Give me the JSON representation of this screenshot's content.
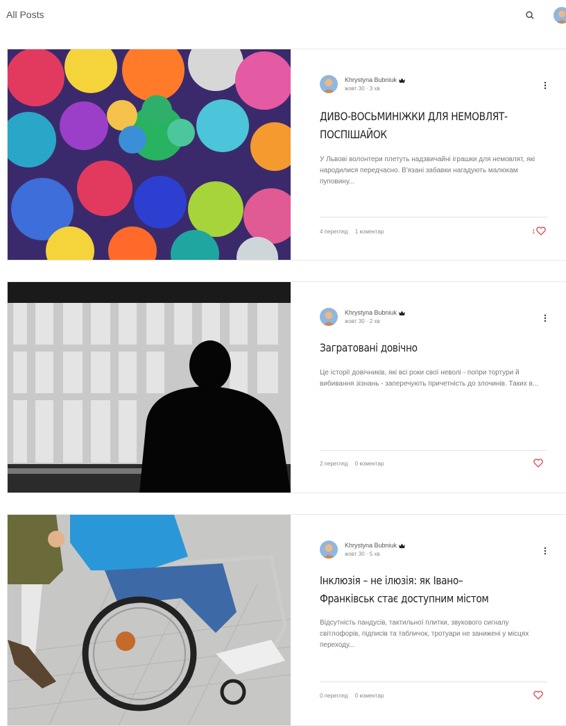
{
  "header": {
    "title": "All Posts"
  },
  "posts": [
    {
      "author": "Khrystyna Bubniuk",
      "date": "жовт 30",
      "read_time": "3 хв",
      "title": "ДИВО-ВОСЬМИНІЖКИ ДЛЯ НЕМОВЛЯТ-ПОСПІШАЙОК",
      "excerpt": "У Львові волонтери плетуть надзвичайні іграшки для немовлят, які народилися передчасно. В'язані забавки нагадують малюкам пуповину...",
      "views": "4 перегляд",
      "comments": "1 коментар",
      "likes": "1",
      "image": "crochet-octopus-toys"
    },
    {
      "author": "Khrystyna Bubniuk",
      "date": "жовт 30",
      "read_time": "2 хв",
      "title": "Загратовані довічно",
      "excerpt": "Це історії довічників, які всі роки свої неволі - попри тортури й вибивання зізнань - заперечують причетність до злочинів. Таких в...",
      "views": "2 перегляд",
      "comments": "0 коментар",
      "likes": "",
      "image": "prison-bars-silhouette"
    },
    {
      "author": "Khrystyna Bubniuk",
      "date": "жовт 30",
      "read_time": "5 хв",
      "title": "Інклюзія – не ілюзія: як Івано–Франківськ стає доступним містом",
      "excerpt": "Відсутність пандусів, тактильної плитки, звукового сигналу світлофорів, підписів та табличок, тротуари не занижені у місцях переходу...",
      "views": "0 перегляд",
      "comments": "0 коментар",
      "likes": "",
      "image": "wheelchair-user"
    }
  ],
  "colors": {
    "accent_like": "#e14d5b",
    "divider": "#e3e3e3",
    "title": "#222222"
  },
  "icons": {
    "search": "search-icon",
    "more": "more-vertical-icon",
    "like": "heart-icon",
    "badge": "crown-icon"
  }
}
